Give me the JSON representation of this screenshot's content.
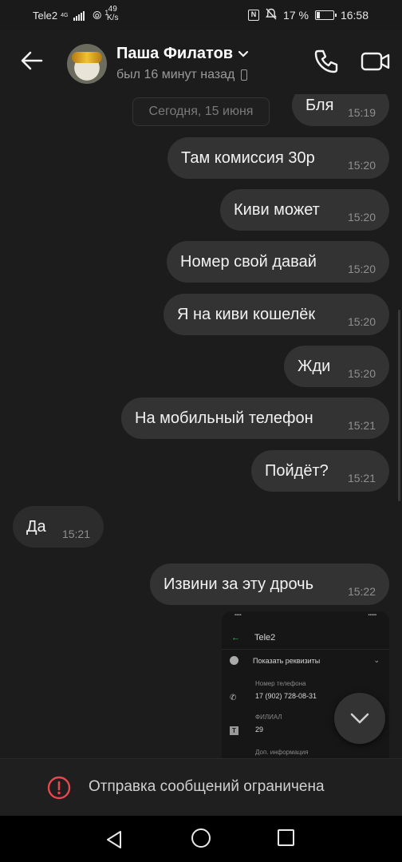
{
  "status_bar": {
    "carrier": "Tele2",
    "network": "4G",
    "hotspot_count": "1",
    "speed_value": "49",
    "speed_unit": "K/s",
    "battery": "17 %",
    "time": "16:58"
  },
  "header": {
    "contact_name": "Паша Филатов",
    "last_seen": "был 16 минут назад"
  },
  "chat": {
    "date_divider": "Сегодня, 15 июня",
    "messages": [
      {
        "text": "Бля",
        "time": "15:19",
        "direction": "out"
      },
      {
        "text": "Там комиссия 30р",
        "time": "15:20",
        "direction": "out"
      },
      {
        "text": "Киви может",
        "time": "15:20",
        "direction": "out"
      },
      {
        "text": "Номер свой давай",
        "time": "15:20",
        "direction": "out"
      },
      {
        "text": "Я на киви кошелёк",
        "time": "15:20",
        "direction": "out"
      },
      {
        "text": "Жди",
        "time": "15:20",
        "direction": "out"
      },
      {
        "text": "На мобильный телефон",
        "time": "15:21",
        "direction": "out"
      },
      {
        "text": "Пойдёт?",
        "time": "15:21",
        "direction": "out"
      },
      {
        "text": "Да",
        "time": "15:21",
        "direction": "in"
      },
      {
        "text": "Извини за эту дрочь",
        "time": "15:22",
        "direction": "out"
      }
    ],
    "screenshot_preview": {
      "title": "Tele2",
      "show_details": "Показать реквизиты",
      "phone_label": "Номер телефона",
      "phone_value": "17 (902) 728-08-31",
      "branch_label": "ФИЛИАЛ",
      "branch_value": "29",
      "extra_label": "Доп. информация"
    }
  },
  "footer": {
    "restriction_text": "Отправка сообщений ограничена"
  },
  "colors": {
    "background": "#1c1c1c",
    "bubble": "#333333",
    "warning": "#e5484d"
  }
}
